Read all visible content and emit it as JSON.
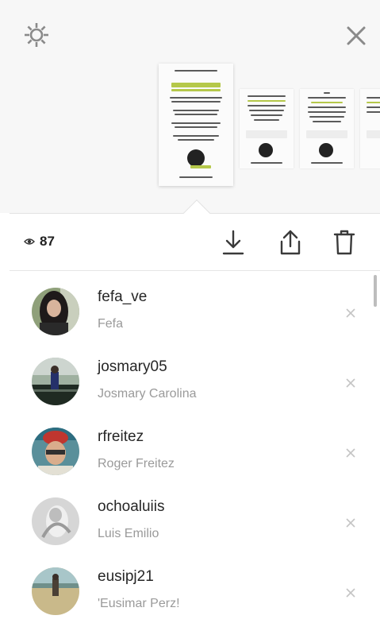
{
  "viewer": {
    "views_count": "87"
  },
  "viewers": [
    {
      "username": "fefa_ve",
      "full_name": "Fefa"
    },
    {
      "username": "josmary05",
      "full_name": "Josmary Carolina"
    },
    {
      "username": "rfreitez",
      "full_name": "Roger Freitez"
    },
    {
      "username": "ochoaluiis",
      "full_name": "Luis Emilio"
    },
    {
      "username": "eusipj21",
      "full_name": "'Eusimar Perz!"
    }
  ],
  "icons": {
    "settings": "gear-icon",
    "close": "close-icon",
    "views": "eye-icon",
    "download": "download-icon",
    "share": "share-icon",
    "delete": "trash-icon",
    "remove": "close-icon"
  },
  "colors": {
    "accent": "#b5c84a",
    "icon": "#3a3a3a",
    "muted": "#9a9a9a"
  }
}
